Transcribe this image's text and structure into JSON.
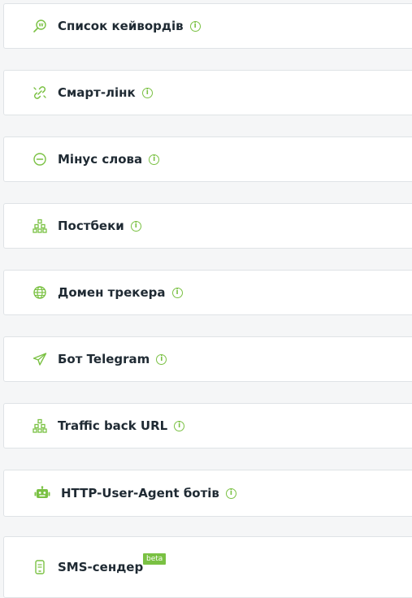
{
  "accent_color": "#7ac143",
  "items": [
    {
      "label": "Список кейвордів",
      "icon": "keyword-search-icon",
      "info_icon": "info-icon"
    },
    {
      "label": "Смарт-лінк",
      "icon": "smart-link-icon",
      "info_icon": "info-icon"
    },
    {
      "label": "Мінус слова",
      "icon": "minus-circle-icon",
      "info_icon": "info-icon"
    },
    {
      "label": "Постбеки",
      "icon": "network-hierarchy-icon",
      "info_icon": "info-icon"
    },
    {
      "label": "Домен трекера",
      "icon": "globe-icon",
      "info_icon": "info-icon"
    },
    {
      "label": "Бот Telegram",
      "icon": "telegram-paper-plane-icon",
      "info_icon": "info-icon"
    },
    {
      "label": "Traffic back URL",
      "icon": "network-hierarchy-icon",
      "info_icon": "info-icon"
    },
    {
      "label": "HTTP-User-Agent ботів",
      "icon": "robot-icon",
      "info_icon": "info-icon"
    },
    {
      "label": "SMS-сендер",
      "icon": "mobile-phone-icon",
      "badge": "beta"
    }
  ]
}
